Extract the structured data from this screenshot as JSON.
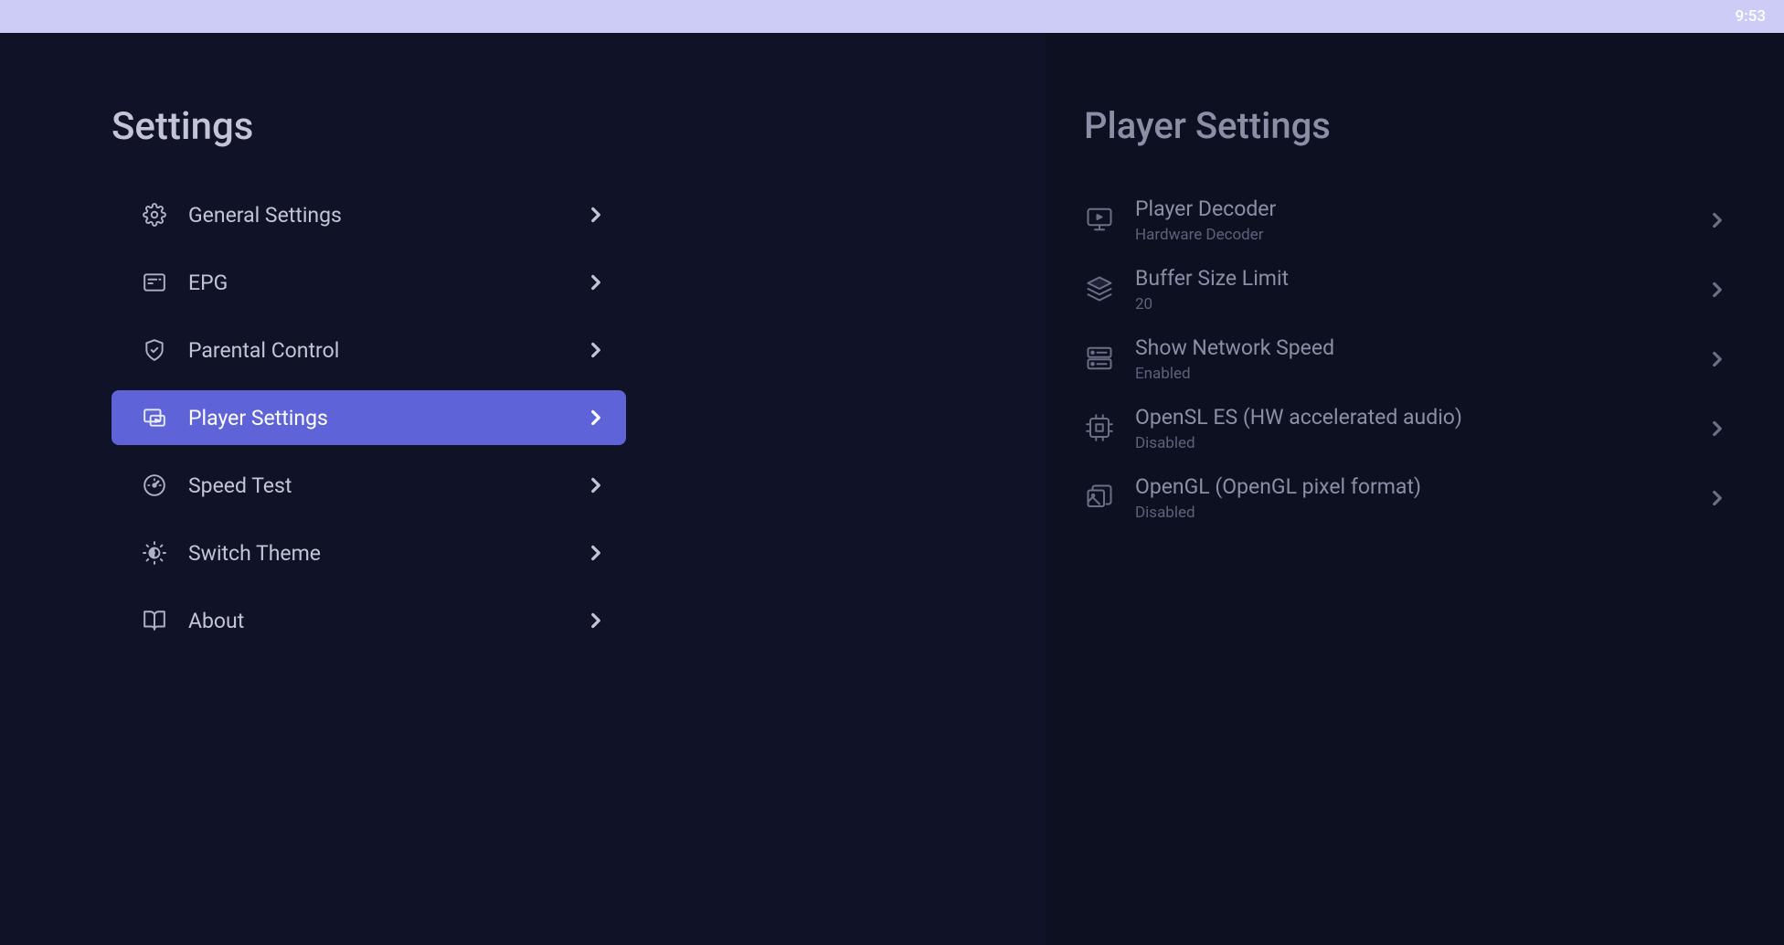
{
  "status_bar": {
    "time": "9:53"
  },
  "left_panel": {
    "title": "Settings",
    "items": [
      {
        "label": "General Settings",
        "icon": "gear-icon",
        "selected": false
      },
      {
        "label": "EPG",
        "icon": "guide-icon",
        "selected": false
      },
      {
        "label": "Parental Control",
        "icon": "shield-icon",
        "selected": false
      },
      {
        "label": "Player Settings",
        "icon": "player-icon",
        "selected": true
      },
      {
        "label": "Speed Test",
        "icon": "speedometer-icon",
        "selected": false
      },
      {
        "label": "Switch Theme",
        "icon": "brightness-icon",
        "selected": false
      },
      {
        "label": "About",
        "icon": "book-icon",
        "selected": false
      }
    ]
  },
  "right_panel": {
    "title": "Player Settings",
    "items": [
      {
        "title": "Player Decoder",
        "subtitle": "Hardware Decoder",
        "icon": "monitor-icon"
      },
      {
        "title": "Buffer Size Limit",
        "subtitle": "20",
        "icon": "layers-icon"
      },
      {
        "title": "Show Network Speed",
        "subtitle": "Enabled",
        "icon": "network-icon"
      },
      {
        "title": "OpenSL ES (HW accelerated audio)",
        "subtitle": "Disabled",
        "icon": "audio-chip-icon"
      },
      {
        "title": "OpenGL (OpenGL pixel format)",
        "subtitle": "Disabled",
        "icon": "images-icon"
      }
    ]
  }
}
